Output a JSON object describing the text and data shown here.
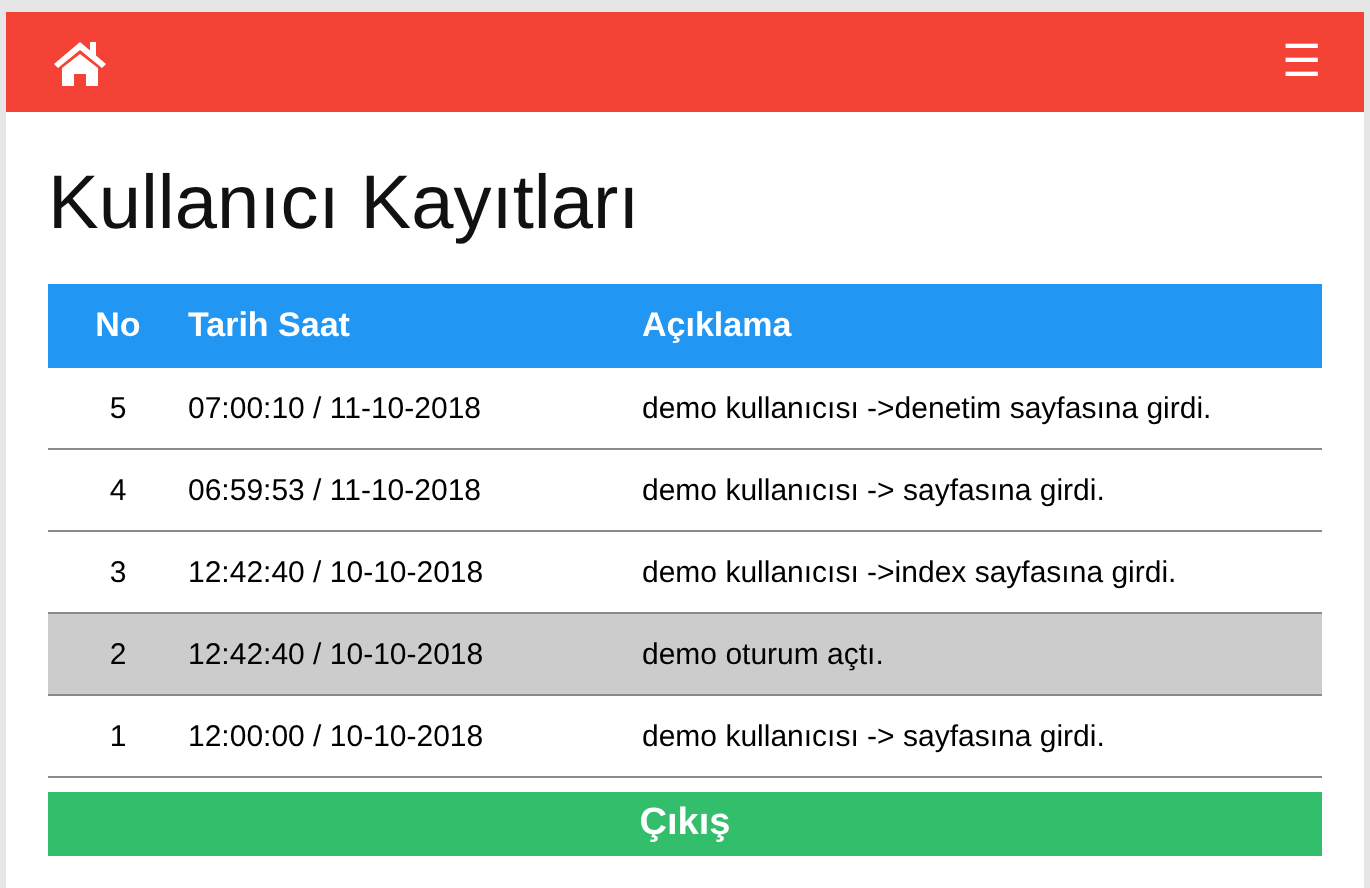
{
  "navbar": {
    "menu_icon": "☰"
  },
  "title": "Kullanıcı Kayıtları",
  "table": {
    "columns": [
      "No",
      "Tarih Saat",
      "Açıklama"
    ],
    "rows": [
      {
        "cells": [
          "5",
          "07:00:10 / 11-10-2018",
          "demo kullanıcısı ->denetim sayfasına girdi."
        ],
        "selected": false
      },
      {
        "cells": [
          "4",
          "06:59:53 / 11-10-2018",
          "demo kullanıcısı -> sayfasına girdi."
        ],
        "selected": false
      },
      {
        "cells": [
          "3",
          "12:42:40 / 10-10-2018",
          "demo kullanıcısı ->index sayfasına girdi."
        ],
        "selected": false
      },
      {
        "cells": [
          "2",
          "12:42:40 / 10-10-2018",
          "demo oturum açtı."
        ],
        "selected": true
      },
      {
        "cells": [
          "1",
          "12:00:00 / 10-10-2018",
          "demo kullanıcısı -> sayfasına girdi."
        ],
        "selected": false
      }
    ]
  },
  "logout_button": "Çıkış"
}
